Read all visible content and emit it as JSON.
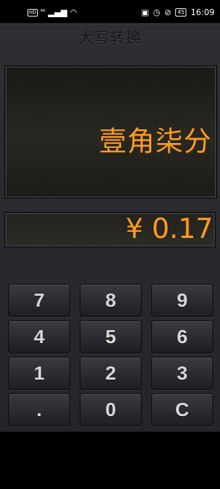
{
  "status_bar": {
    "hd": "HD",
    "signal": "⁴⁶",
    "battery": "45",
    "time": "16:09"
  },
  "app": {
    "title": "大写转换",
    "chinese_amount": "壹角柒分",
    "amount": "¥ 0.17"
  },
  "keypad": {
    "keys": [
      "7",
      "8",
      "9",
      "4",
      "5",
      "6",
      "1",
      "2",
      "3",
      ".",
      "0",
      "C"
    ]
  }
}
